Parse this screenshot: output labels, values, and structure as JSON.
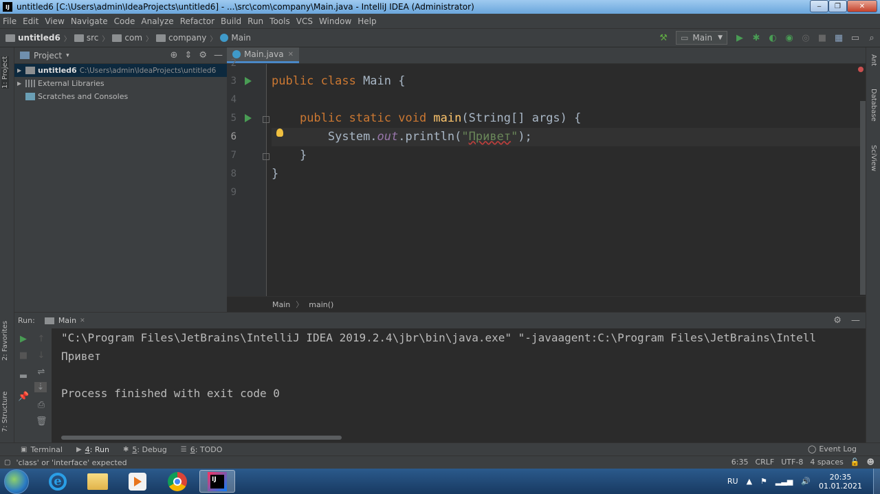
{
  "window": {
    "title": "untitled6 [C:\\Users\\admin\\IdeaProjects\\untitled6] - ...\\src\\com\\company\\Main.java - IntelliJ IDEA (Administrator)",
    "app_icon": "IJ",
    "minimize": "‒",
    "maximize": "❐",
    "close": "✕"
  },
  "menu": [
    "File",
    "Edit",
    "View",
    "Navigate",
    "Code",
    "Analyze",
    "Refactor",
    "Build",
    "Run",
    "Tools",
    "VCS",
    "Window",
    "Help"
  ],
  "breadcrumbs": [
    "untitled6",
    "src",
    "com",
    "company",
    "Main"
  ],
  "toolbar": {
    "run_config": "Main"
  },
  "left_strip": {
    "project_tab": "1: Project",
    "favorites_tab": "2: Favorites",
    "structure_tab": "7: Structure"
  },
  "right_strip": {
    "ant_tab": "Ant",
    "database_tab": "Database",
    "sciview_tab": "SciView"
  },
  "project_panel": {
    "title": "Project",
    "dropdown": "▾",
    "tree": [
      {
        "label": "untitled6",
        "path": "C:\\Users\\admin\\IdeaProjects\\untitled6"
      },
      {
        "label": "External Libraries"
      },
      {
        "label": "Scratches and Consoles"
      }
    ]
  },
  "editor": {
    "tab_label": "Main.java",
    "line_numbers": [
      "2",
      "3",
      "4",
      "5",
      "6",
      "7",
      "8",
      "9"
    ],
    "code": {
      "l3_kw": "public class ",
      "l3_name": "Main {",
      "l5_kw": "public static void ",
      "l5_fn": "main",
      "l5_rest": "(String[] args) {",
      "l6_a": "System.",
      "l6_field": "out",
      "l6_b": ".println(",
      "l6_q1": "\"",
      "l6_str": "Привет",
      "l6_q2": "\"",
      "l6_c": ");",
      "l7": "}",
      "l8": "}"
    },
    "footer_crumbs": [
      "Main",
      "main()"
    ]
  },
  "run_panel": {
    "label": "Run:",
    "tab": "Main",
    "console_lines": [
      "\"C:\\Program Files\\JetBrains\\IntelliJ IDEA 2019.2.4\\jbr\\bin\\java.exe\" \"-javaagent:C:\\Program Files\\JetBrains\\Intell",
      "Привет",
      "",
      "Process finished with exit code 0"
    ]
  },
  "bottom_tabs": {
    "terminal": "Terminal",
    "run_num": "4",
    "run": ": Run",
    "debug_num": "5",
    "debug": ": Debug",
    "todo_num": "6",
    "todo": ": TODO",
    "event_log": "Event Log"
  },
  "status_bar": {
    "message": "'class' or 'interface' expected",
    "position": "6:35",
    "line_separator": "CRLF",
    "encoding": "UTF-8",
    "indent": "4 spaces"
  },
  "taskbar": {
    "language": "RU",
    "time": "20:35",
    "date": "01.01.2021",
    "ij_label": "IJ"
  },
  "colors": {
    "editor_bg": "#2b2b2b",
    "panel_bg": "#3c3f41",
    "keyword": "#cc7832",
    "function": "#ffc66d",
    "string": "#6a8759",
    "run_green": "#499c54"
  }
}
